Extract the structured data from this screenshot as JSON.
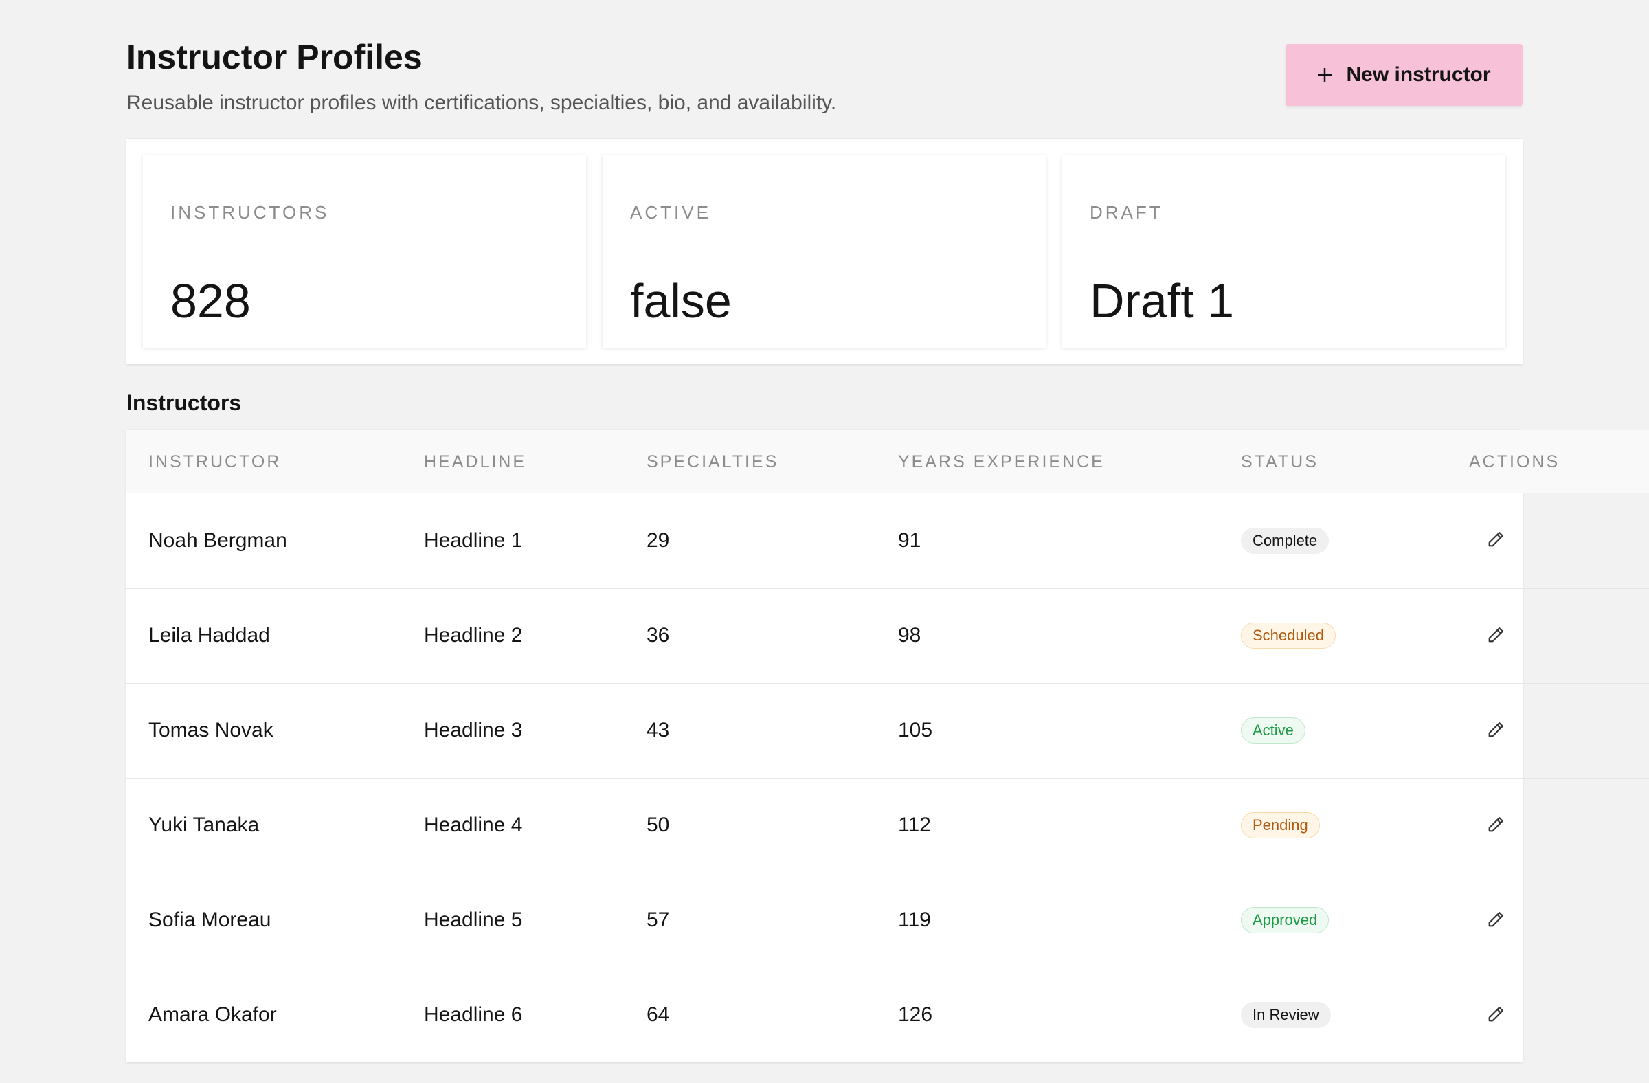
{
  "header": {
    "title": "Instructor Profiles",
    "subtitle": "Reusable instructor profiles with certifications, specialties, bio, and availability.",
    "new_button_label": "New instructor",
    "new_button_icon": "plus-icon",
    "accent_color": "#f7c1d8"
  },
  "stats": [
    {
      "label": "INSTRUCTORS",
      "value": "828"
    },
    {
      "label": "ACTIVE",
      "value": "false"
    },
    {
      "label": "DRAFT",
      "value": "Draft 1"
    }
  ],
  "section_title": "Instructors",
  "table": {
    "columns": [
      "INSTRUCTOR",
      "HEADLINE",
      "SPECIALTIES",
      "YEARS EXPERIENCE",
      "STATUS",
      "ACTIONS"
    ],
    "rows": [
      {
        "instructor": "Noah Bergman",
        "headline": "Headline 1",
        "specialties": "29",
        "years": "91",
        "status": "Complete",
        "status_tone": "neutral",
        "action_icon": "pencil-icon"
      },
      {
        "instructor": "Leila Haddad",
        "headline": "Headline 2",
        "specialties": "36",
        "years": "98",
        "status": "Scheduled",
        "status_tone": "amber",
        "action_icon": "pencil-icon"
      },
      {
        "instructor": "Tomas Novak",
        "headline": "Headline 3",
        "specialties": "43",
        "years": "105",
        "status": "Active",
        "status_tone": "green",
        "action_icon": "pencil-icon"
      },
      {
        "instructor": "Yuki Tanaka",
        "headline": "Headline 4",
        "specialties": "50",
        "years": "112",
        "status": "Pending",
        "status_tone": "amber",
        "action_icon": "pencil-icon"
      },
      {
        "instructor": "Sofia Moreau",
        "headline": "Headline 5",
        "specialties": "57",
        "years": "119",
        "status": "Approved",
        "status_tone": "green",
        "action_icon": "pencil-icon"
      },
      {
        "instructor": "Amara Okafor",
        "headline": "Headline 6",
        "specialties": "64",
        "years": "126",
        "status": "In Review",
        "status_tone": "neutral",
        "action_icon": "pencil-icon"
      }
    ]
  },
  "colors": {
    "background": "#f2f2f2",
    "badge_neutral": "#f0f0f0",
    "badge_amber_text": "#b05a10",
    "badge_green_text": "#1f9a48"
  }
}
